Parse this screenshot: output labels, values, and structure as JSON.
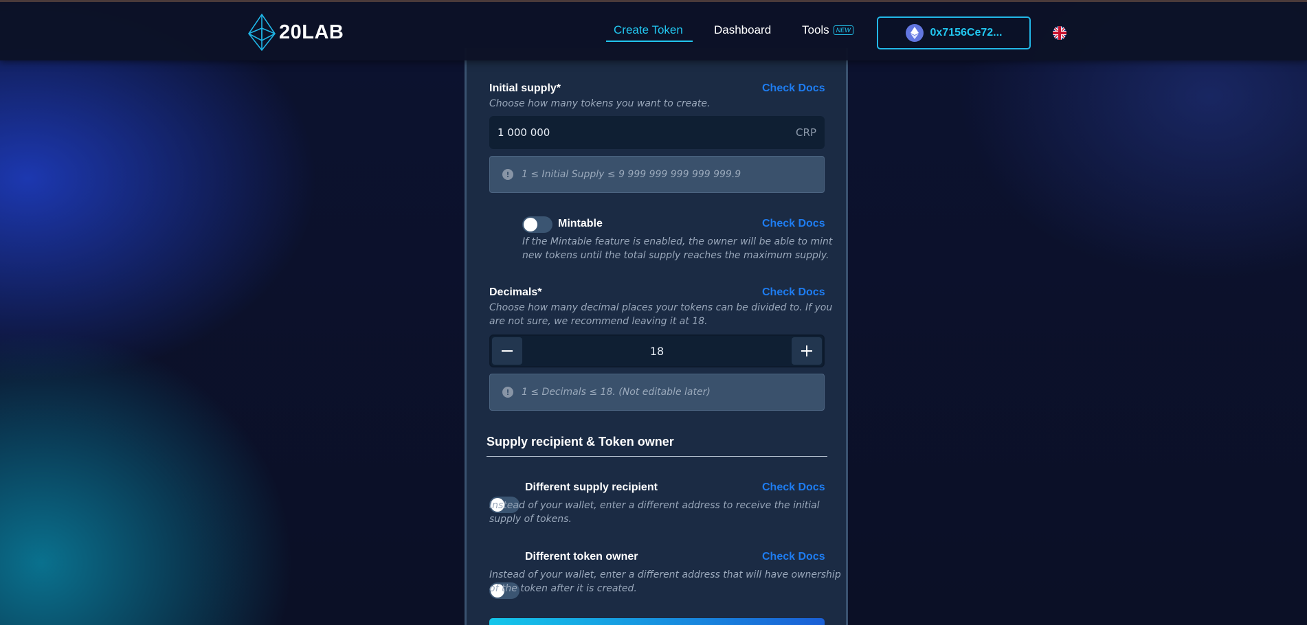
{
  "brand": {
    "name": "20LAB"
  },
  "nav": {
    "create_token": "Create Token",
    "dashboard": "Dashboard",
    "tools": "Tools",
    "tools_badge": "NEW"
  },
  "wallet": {
    "address": "0x7156Ce72..."
  },
  "form": {
    "initial_supply": {
      "label": "Initial supply*",
      "docs": "Check Docs",
      "description": "Choose how many tokens you want to create.",
      "value": "1 000 000",
      "unit": "CRP",
      "hint": "1 ≤ Initial Supply ≤ 9 999 999 999 999 999.9"
    },
    "mintable": {
      "label": "Mintable",
      "docs": "Check Docs",
      "description_line1": "If the Mintable feature is enabled, the owner will be able to mint",
      "description_line2": "new tokens until the total supply reaches the maximum supply.",
      "enabled": false
    },
    "decimals": {
      "label": "Decimals*",
      "docs": "Check Docs",
      "description_line1": "Choose how many decimal places your tokens can be divided to. If you",
      "description_line2": "are not sure, we recommend leaving it at 18.",
      "value": "18",
      "hint": "1 ≤ Decimals ≤ 18. (Not editable later)"
    },
    "section_title": "Supply recipient & Token owner",
    "different_recipient": {
      "label": "Different supply recipient",
      "docs": "Check Docs",
      "description_line1": "Instead of your wallet, enter a different address to receive the initial",
      "description_line2": "supply of tokens.",
      "enabled": false
    },
    "different_owner": {
      "label": "Different token owner",
      "docs": "Check Docs",
      "description_line1": "Instead of your wallet, enter a different address that will have ownership",
      "description_line2": "of the token after it is created.",
      "enabled": false
    }
  },
  "colors": {
    "accent": "#22c7f0",
    "link": "#1e7cf0",
    "panel": "#1b2b44"
  }
}
